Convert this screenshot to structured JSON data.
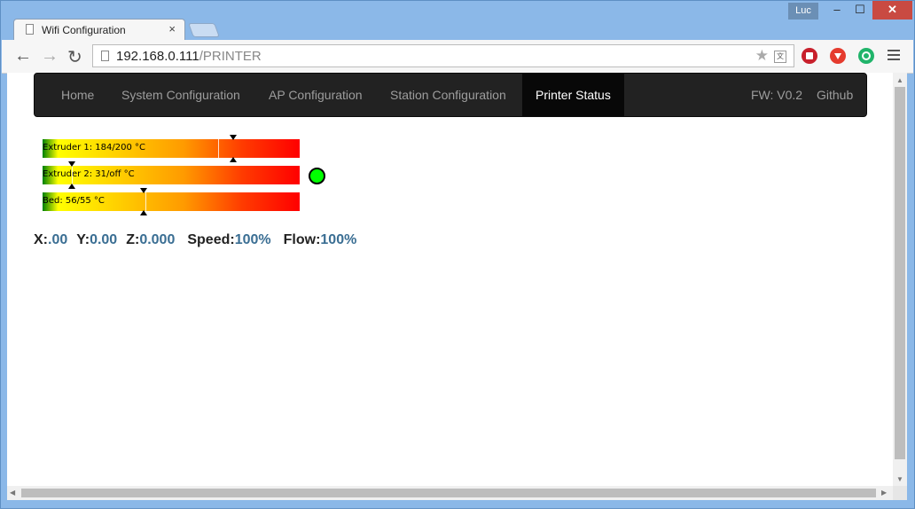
{
  "browser": {
    "tab_title": "Wifi Configuration",
    "tab_close": "×",
    "user": "Luc",
    "url_host": "192.168.0.111",
    "url_path": "/PRINTER",
    "window_controls": {
      "minimize": "–",
      "maximize": "☐",
      "close": "✕"
    },
    "icons": [
      "back-arrow-icon",
      "forward-arrow-icon",
      "reload-icon",
      "star-icon",
      "translate-icon",
      "stop-extension-icon",
      "download-extension-icon",
      "circle-extension-icon",
      "menu-icon"
    ]
  },
  "navbar": {
    "items": [
      {
        "label": "Home",
        "active": false
      },
      {
        "label": "System Configuration",
        "active": false
      },
      {
        "label": "AP Configuration",
        "active": false
      },
      {
        "label": "Station Configuration",
        "active": false
      },
      {
        "label": "Printer Status",
        "active": true
      }
    ],
    "right_items": [
      {
        "label": "FW: V0.2"
      },
      {
        "label": "Github"
      }
    ]
  },
  "temperatures": [
    {
      "label": "Extruder 1: 184/200 °C",
      "current": 184,
      "target": 200,
      "scale_max": 270
    },
    {
      "label": "Extruder 2: 31/off °C",
      "current": 31,
      "target": null,
      "scale_max": 270
    },
    {
      "label": "Bed: 56/55 °C",
      "current": 56,
      "target": 55,
      "scale_max": 140
    }
  ],
  "status_indicator": {
    "color": "#00ff00"
  },
  "position": {
    "x_label": "X:",
    "x_value": ".00",
    "y_label": "Y:",
    "y_value": "0.00",
    "z_label": "Z:",
    "z_value": "0.000",
    "speed_label": "Speed:",
    "speed_value": "100%",
    "flow_label": "Flow:",
    "flow_value": "100%"
  }
}
